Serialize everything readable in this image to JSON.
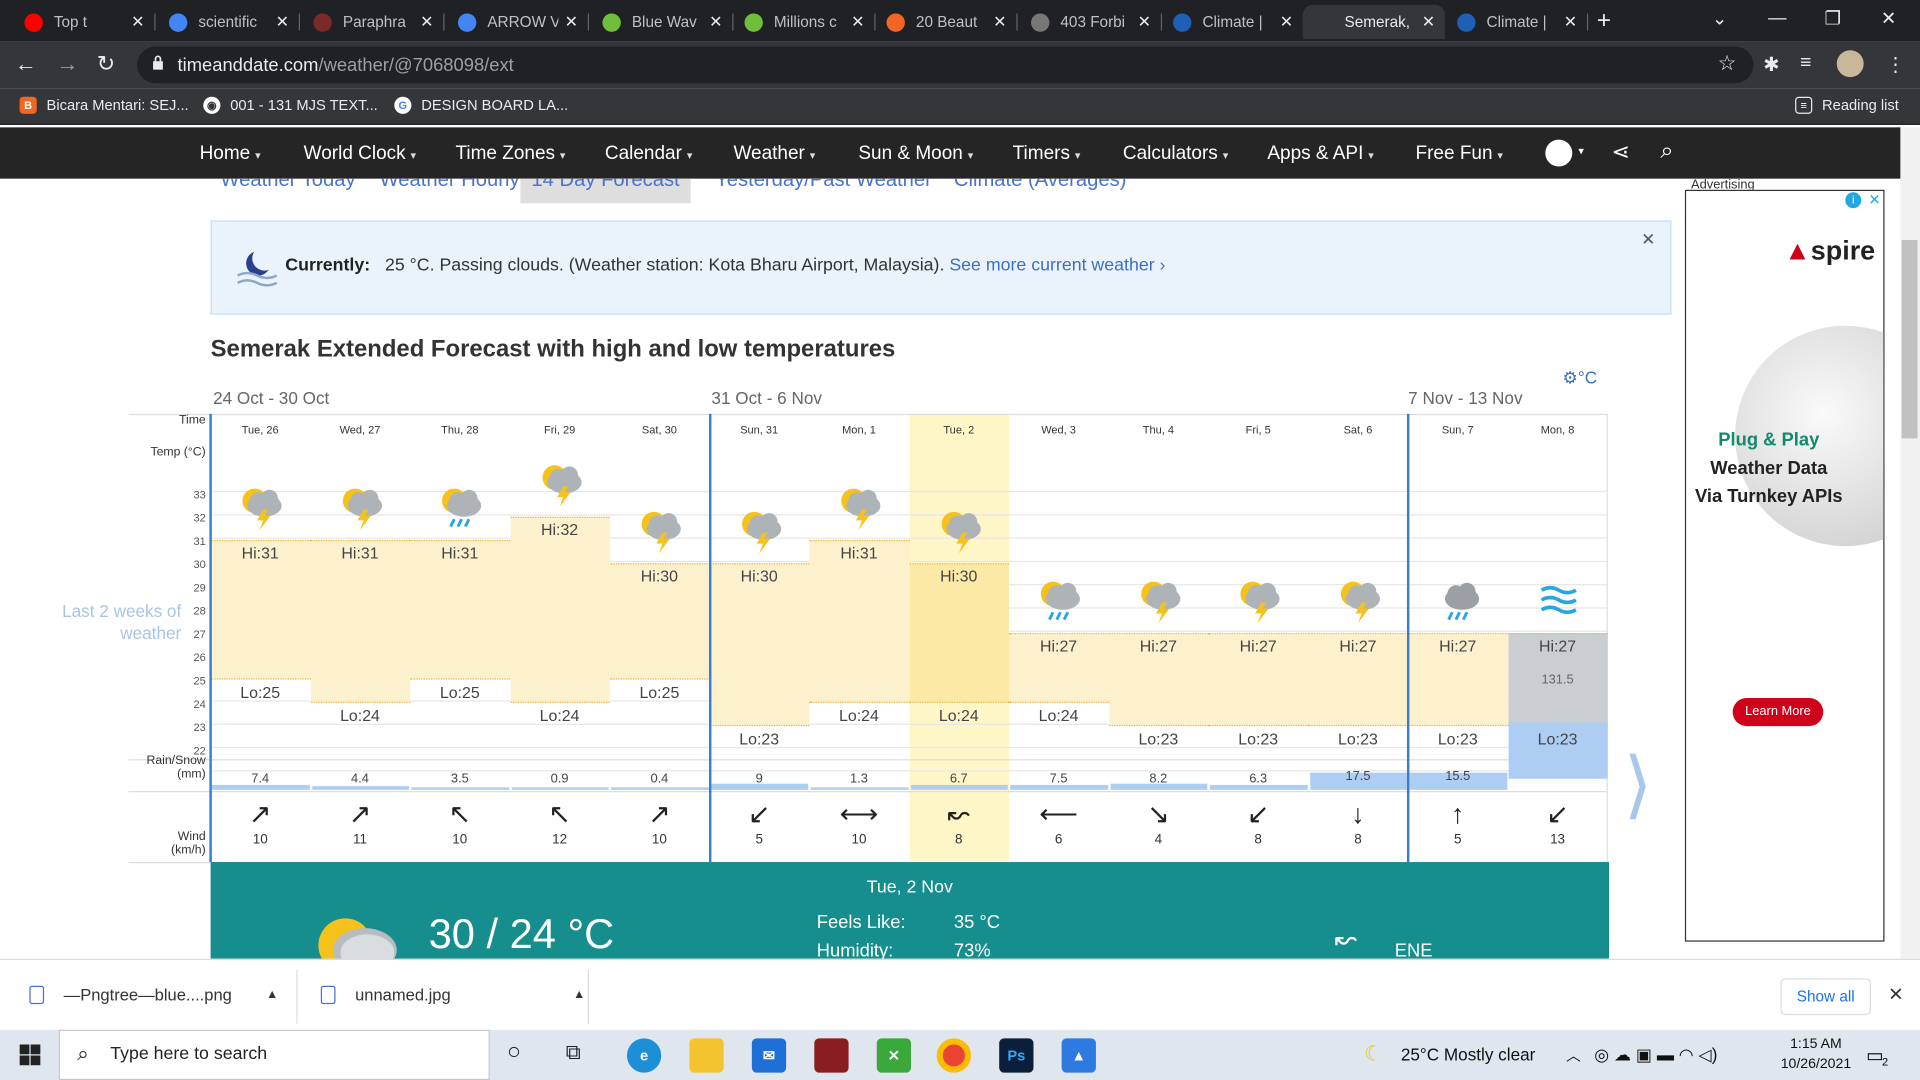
{
  "browser": {
    "tabs": [
      {
        "title": "Top t",
        "fav": "youtube-icon",
        "color": "#ff0000"
      },
      {
        "title": "scientific",
        "fav": "google-icon",
        "color": "#4285f4"
      },
      {
        "title": "Paraphra",
        "fav": "paraphrase-icon",
        "color": "#7a2a2a"
      },
      {
        "title": "ARROW V",
        "fav": "google-icon",
        "color": "#4285f4"
      },
      {
        "title": "Blue Wav",
        "fav": "pngtree-icon",
        "color": "#6fbf3b"
      },
      {
        "title": "Millions c",
        "fav": "pngtree-icon",
        "color": "#6fbf3b"
      },
      {
        "title": "20 Beaut",
        "fav": "blogger-icon",
        "color": "#f26522"
      },
      {
        "title": "403 Forbi",
        "fav": "globe-icon",
        "color": "#777777"
      },
      {
        "title": "Climate |",
        "fav": "noaa-icon",
        "color": "#1f5fb5"
      },
      {
        "title": "Semerak,",
        "fav": "timeanddate-icon",
        "color": "#35363a"
      },
      {
        "title": "Climate |",
        "fav": "noaa-icon",
        "color": "#1f5fb5"
      }
    ],
    "url_host": "timeanddate.com",
    "url_path": "/weather/@7068098/ext",
    "bookmarks": [
      "Bicara Mentari: SEJ...",
      "001 - 131 MJS TEXT...",
      "DESIGN BOARD LA..."
    ],
    "reading_list": "Reading list"
  },
  "nav": {
    "items": [
      "Home",
      "World Clock",
      "Time Zones",
      "Calendar",
      "Weather",
      "Sun & Moon",
      "Timers",
      "Calculators",
      "Apps & API",
      "Free Fun"
    ]
  },
  "subtabs": [
    "Weather Today",
    "Weather Hourly",
    "14 Day Forecast",
    "Yesterday/Past Weather",
    "Climate (Averages)"
  ],
  "current": {
    "label": "Currently:",
    "text": "25 °C. Passing clouds. (Weather station: Kota Bharu Airport, Malaysia).",
    "link": "See more current weather"
  },
  "heading": "Semerak Extended Forecast with high and low temperatures",
  "unit": "°C",
  "chart": {
    "weeks": [
      "24 Oct - 30 Oct",
      "31 Oct - 6 Nov",
      "7 Nov - 13 Nov"
    ],
    "labels": {
      "time": "Time",
      "temp": "Temp (°C)",
      "rain": "Rain/Snow (mm)",
      "wind": "Wind (km/h)"
    },
    "yticks": [
      "33",
      "32",
      "31",
      "30",
      "29",
      "28",
      "27",
      "26",
      "25",
      "24",
      "23",
      "22"
    ],
    "left_note": "Last 2 weeks of weather",
    "days": [
      {
        "label": "Tue, 26",
        "hi": "Hi:31",
        "lo": "Lo:25",
        "rain": "7.4",
        "wind": "10",
        "wdir": "↗",
        "icon": "thunder"
      },
      {
        "label": "Wed, 27",
        "hi": "Hi:31",
        "lo": "Lo:24",
        "rain": "4.4",
        "wind": "11",
        "wdir": "↗",
        "icon": "thunder"
      },
      {
        "label": "Thu, 28",
        "hi": "Hi:31",
        "lo": "Lo:25",
        "rain": "3.5",
        "wind": "10",
        "wdir": "↖",
        "icon": "sunrain"
      },
      {
        "label": "Fri, 29",
        "hi": "Hi:32",
        "lo": "Lo:24",
        "rain": "0.9",
        "wind": "12",
        "wdir": "↖",
        "icon": "thunder"
      },
      {
        "label": "Sat, 30",
        "hi": "Hi:30",
        "lo": "Lo:25",
        "rain": "0.4",
        "wind": "10",
        "wdir": "↗",
        "icon": "thunder"
      },
      {
        "label": "Sun, 31",
        "hi": "Hi:30",
        "lo": "Lo:23",
        "rain": "9",
        "wind": "5",
        "wdir": "↙",
        "icon": "thunder"
      },
      {
        "label": "Mon, 1",
        "hi": "Hi:31",
        "lo": "Lo:24",
        "rain": "1.3",
        "wind": "10",
        "wdir": "⟷",
        "icon": "thunder"
      },
      {
        "label": "Tue, 2",
        "hi": "Hi:30",
        "lo": "Lo:24",
        "rain": "6.7",
        "wind": "8",
        "wdir": "↜",
        "icon": "thunder"
      },
      {
        "label": "Wed, 3",
        "hi": "Hi:27",
        "lo": "Lo:24",
        "rain": "7.5",
        "wind": "6",
        "wdir": "⟵",
        "icon": "sunrain"
      },
      {
        "label": "Thu, 4",
        "hi": "Hi:27",
        "lo": "Lo:23",
        "rain": "8.2",
        "wind": "4",
        "wdir": "↘",
        "icon": "thunder"
      },
      {
        "label": "Fri, 5",
        "hi": "Hi:27",
        "lo": "Lo:23",
        "rain": "6.3",
        "wind": "8",
        "wdir": "↙",
        "icon": "thunder"
      },
      {
        "label": "Sat, 6",
        "hi": "Hi:27",
        "lo": "Lo:23",
        "rain": "17.5",
        "wind": "8",
        "wdir": "↓",
        "icon": "thunder"
      },
      {
        "label": "Sun, 7",
        "hi": "Hi:27",
        "lo": "Lo:23",
        "rain": "15.5",
        "wind": "5",
        "wdir": "↑",
        "icon": "rain"
      },
      {
        "label": "Mon, 8",
        "hi": "Hi:27",
        "lo": "Lo:23",
        "rain": "131.5",
        "wind": "13",
        "wdir": "↙",
        "icon": "fog"
      }
    ]
  },
  "detail": {
    "date": "Tue, 2 Nov",
    "temp": "30 / 24 °C",
    "feels_label": "Feels Like:",
    "feels": "35 °C",
    "humidity_label": "Humidity:",
    "humidity": "73%",
    "wind_dir": "ENE"
  },
  "ad": {
    "label": "Advertising",
    "brand": "spire",
    "line1": "Plug & Play",
    "line2": "Weather Data",
    "line3": "Via Turnkey APIs",
    "cta": "Learn More"
  },
  "downloads": {
    "items": [
      "—Pngtree—blue....png",
      "unnamed.jpg"
    ],
    "show_all": "Show all"
  },
  "taskbar": {
    "search_placeholder": "Type here to search",
    "weather": "25°C  Mostly clear",
    "time": "1:15 AM",
    "date": "10/26/2021",
    "notif": "2"
  }
}
